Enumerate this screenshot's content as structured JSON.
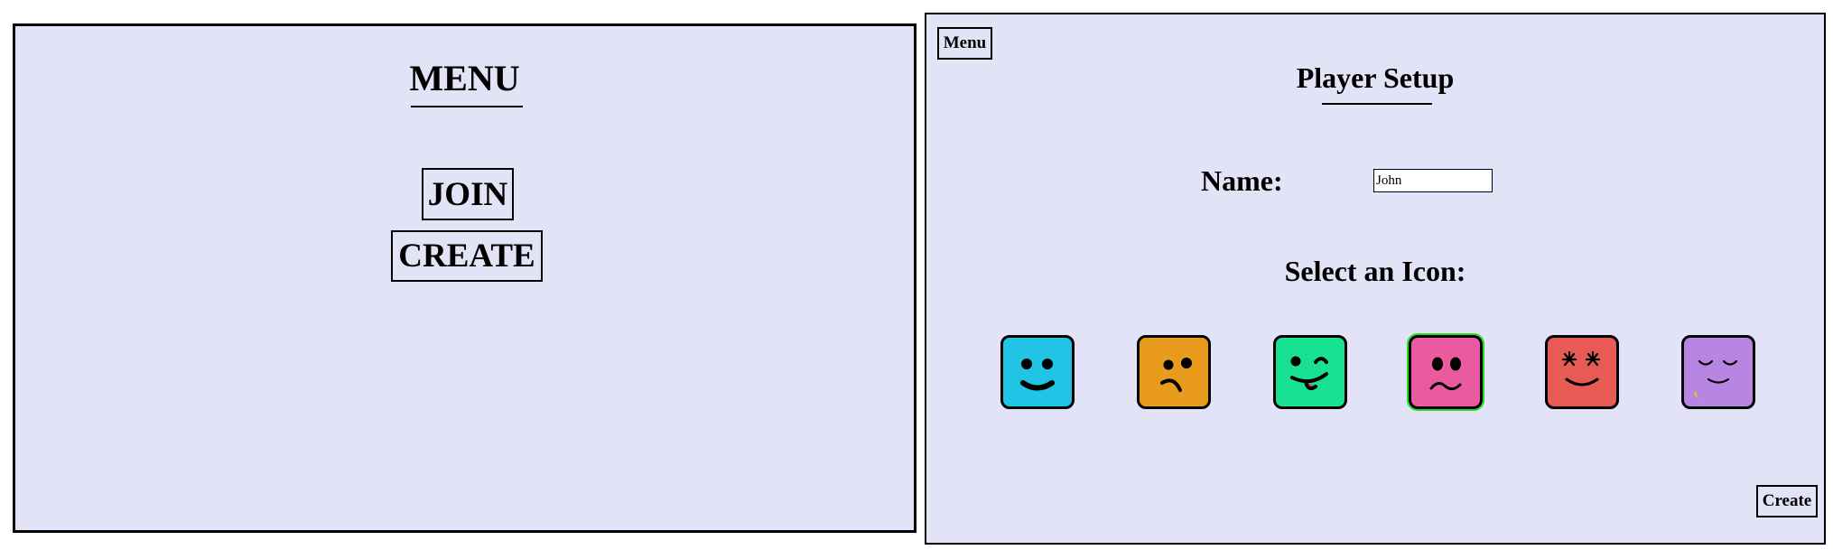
{
  "menu_screen": {
    "title": "MENU",
    "join_label": "JOIN",
    "create_label": "CREATE"
  },
  "setup_screen": {
    "menu_button_label": "Menu",
    "title": "Player Setup",
    "name_label": "Name:",
    "name_value": "John",
    "select_icon_label": "Select an Icon:",
    "create_button_label": "Create",
    "icons": [
      {
        "name": "happy-face-icon",
        "color": "#22c4e6"
      },
      {
        "name": "unsure-face-icon",
        "color": "#e89b1c"
      },
      {
        "name": "wink-face-icon",
        "color": "#18e291"
      },
      {
        "name": "worried-face-icon",
        "color": "#ea5a9e"
      },
      {
        "name": "grin-face-icon",
        "color": "#e85a55"
      },
      {
        "name": "sleepy-face-icon",
        "color": "#b985e3"
      }
    ],
    "selected_icon_index": 3,
    "selected_outline_color": "#22dd22"
  }
}
